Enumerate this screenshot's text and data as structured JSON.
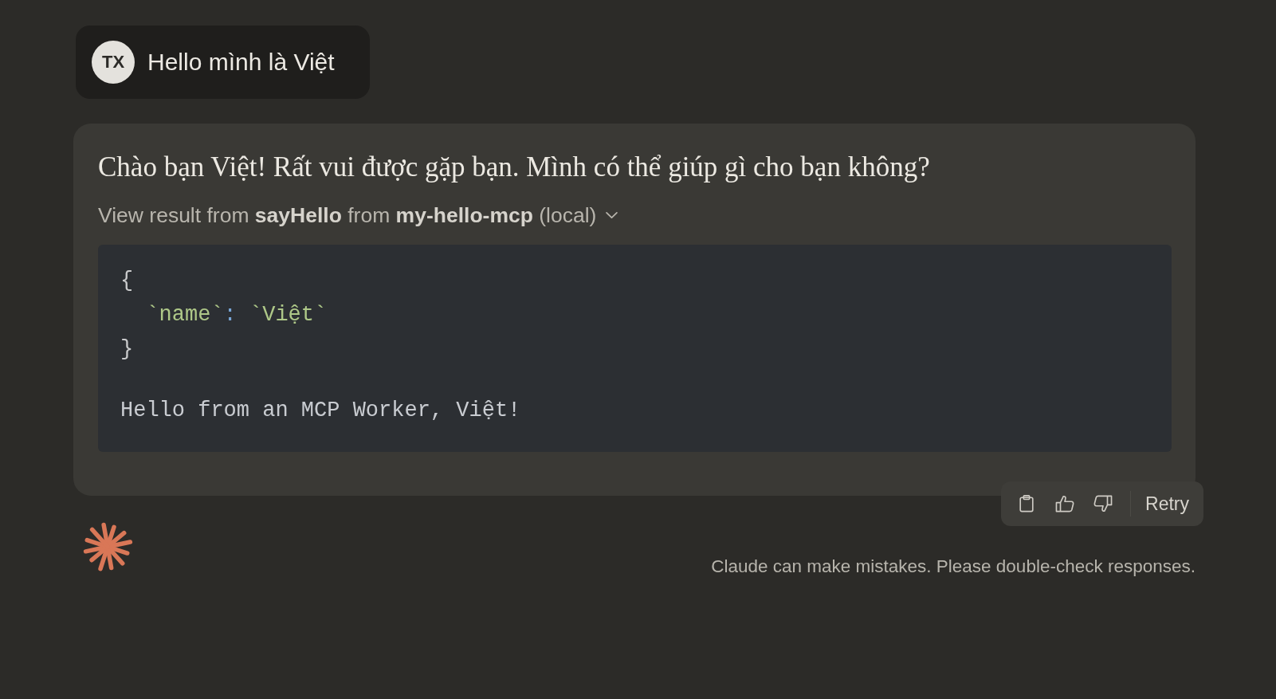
{
  "user_message": {
    "avatar_initials": "TX",
    "text": "Hello mình là Việt"
  },
  "assistant_message": {
    "text": "Chào bạn Việt! Rất vui được gặp bạn. Mình có thể giúp gì cho bạn không?",
    "tool_result": {
      "label": "View result from **sayHello** from **my-hello-mcp** (local)",
      "expanded": true,
      "json": {
        "open": "{",
        "entries": [
          {
            "key": "`name`",
            "separator": ":",
            "value": "`Việt`"
          }
        ],
        "close": "}"
      },
      "output": "Hello from an MCP Worker, Việt!"
    }
  },
  "actions": [
    {
      "kind": "copy"
    },
    {
      "kind": "thumbs_up"
    },
    {
      "kind": "thumbs_down"
    },
    {
      "kind": "retry",
      "label": "Retry"
    }
  ],
  "disclaimer": "Claude can make mistakes. Please double-check responses."
}
